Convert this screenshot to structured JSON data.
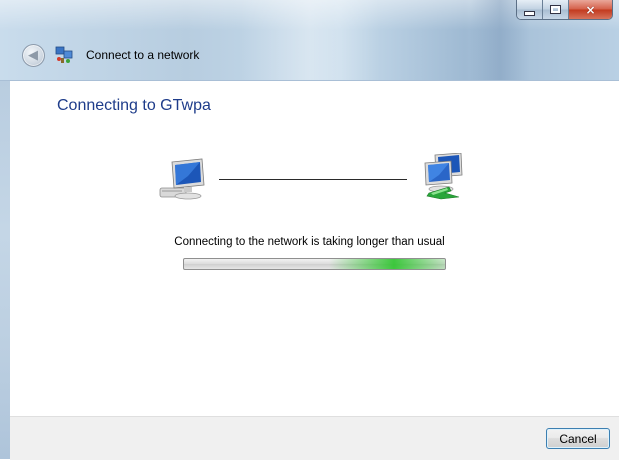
{
  "window": {
    "title": "Connect to a network",
    "controls": {
      "minimize": "minimize",
      "maximize": "maximize",
      "close": "×"
    }
  },
  "nav": {
    "back_icon": "back-arrow-icon",
    "network_icon": "network-icon"
  },
  "main": {
    "heading": "Connecting to GTwpa",
    "status_text": "Connecting to the network is taking longer than usual",
    "progress": {
      "type": "indeterminate-marquee",
      "accent_color": "#2cc42c"
    }
  },
  "footer": {
    "cancel_label": "Cancel"
  },
  "colors": {
    "heading": "#1e3c8a",
    "footer_bg": "#f0f0f0",
    "close_button": "#c23a1f"
  }
}
